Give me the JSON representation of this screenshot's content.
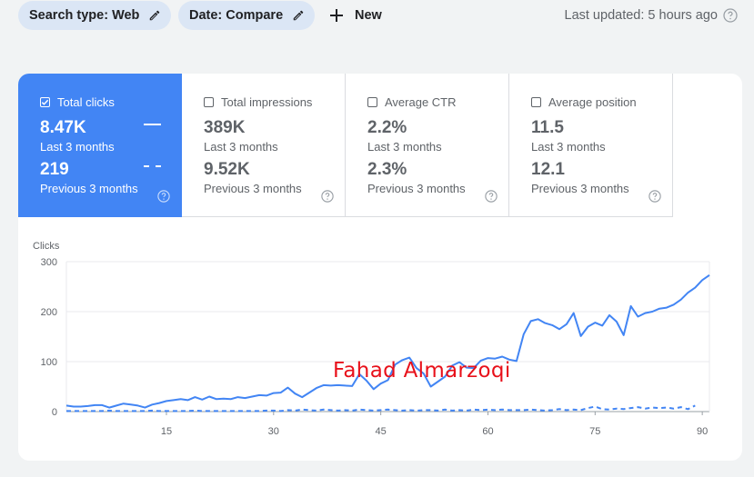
{
  "filters": {
    "search_type_label": "Search type: Web",
    "date_label": "Date: Compare"
  },
  "new_button": {
    "label": "New"
  },
  "last_updated": "Last updated: 5 hours ago",
  "metrics": [
    {
      "name": "Total clicks",
      "checked": true,
      "current_value": "8.47K",
      "current_period": "Last 3 months",
      "previous_value": "219",
      "previous_period": "Previous 3 months",
      "color": "#4285f4"
    },
    {
      "name": "Total impressions",
      "checked": false,
      "current_value": "389K",
      "current_period": "Last 3 months",
      "previous_value": "9.52K",
      "previous_period": "Previous 3 months"
    },
    {
      "name": "Average CTR",
      "checked": false,
      "current_value": "2.2%",
      "current_period": "Last 3 months",
      "previous_value": "2.3%",
      "previous_period": "Previous 3 months"
    },
    {
      "name": "Average position",
      "checked": false,
      "current_value": "11.5",
      "current_period": "Last 3 months",
      "previous_value": "12.1",
      "previous_period": "Previous 3 months"
    }
  ],
  "watermark": "Fahad Almarzoqi",
  "chart_data": {
    "type": "line",
    "ylabel": "Clicks",
    "xlabel": "",
    "ylim": [
      0,
      300
    ],
    "yticks": [
      0,
      100,
      200,
      300
    ],
    "xlim": [
      1,
      91
    ],
    "xticks": [
      15,
      30,
      45,
      60,
      75,
      90
    ],
    "grid": true,
    "colors": {
      "line": "#4285f4",
      "grid": "#e8eaed"
    },
    "series": [
      {
        "style": "solid",
        "x": [
          1,
          2,
          3,
          4,
          5,
          6,
          7,
          8,
          9,
          10,
          11,
          12,
          13,
          14,
          15,
          16,
          17,
          18,
          19,
          20,
          21,
          22,
          23,
          24,
          25,
          26,
          27,
          28,
          29,
          30,
          31,
          32,
          33,
          34,
          35,
          36,
          37,
          38,
          39,
          40,
          41,
          42,
          43,
          44,
          45,
          46,
          47,
          48,
          49,
          50,
          51,
          52,
          53,
          54,
          55,
          56,
          57,
          58,
          59,
          60,
          61,
          62,
          63,
          64,
          65,
          66,
          67,
          68,
          69,
          70,
          71,
          72,
          73,
          74,
          75,
          76,
          77,
          78,
          79,
          80,
          81,
          82,
          83,
          84,
          85,
          86,
          87,
          88,
          89,
          90,
          91
        ],
        "values": [
          12,
          10,
          10,
          11,
          13,
          13,
          8,
          12,
          16,
          14,
          12,
          8,
          14,
          17,
          21,
          23,
          25,
          23,
          29,
          24,
          30,
          25,
          26,
          25,
          29,
          27,
          30,
          33,
          32,
          37,
          38,
          48,
          36,
          29,
          38,
          47,
          53,
          52,
          53,
          52,
          51,
          75,
          62,
          45,
          56,
          63,
          94,
          103,
          108,
          87,
          76,
          50,
          60,
          70,
          92,
          99,
          88,
          87,
          102,
          107,
          106,
          110,
          104,
          101,
          155,
          181,
          185,
          177,
          173,
          165,
          175,
          197,
          151,
          170,
          178,
          172,
          193,
          180,
          153,
          211,
          190,
          197,
          200,
          206,
          208,
          214,
          224,
          238,
          248,
          263,
          273
        ]
      },
      {
        "style": "dashed",
        "x": [
          1,
          2,
          3,
          4,
          5,
          6,
          7,
          8,
          9,
          10,
          11,
          12,
          13,
          14,
          15,
          16,
          17,
          18,
          19,
          20,
          21,
          22,
          23,
          24,
          25,
          26,
          27,
          28,
          29,
          30,
          31,
          32,
          33,
          34,
          35,
          36,
          37,
          38,
          39,
          40,
          41,
          42,
          43,
          44,
          45,
          46,
          47,
          48,
          49,
          50,
          51,
          52,
          53,
          54,
          55,
          56,
          57,
          58,
          59,
          60,
          61,
          62,
          63,
          64,
          65,
          66,
          67,
          68,
          69,
          70,
          71,
          72,
          73,
          74,
          75,
          76,
          77,
          78,
          79,
          80,
          81,
          82,
          83,
          84,
          85,
          86,
          87,
          88,
          89
        ],
        "values": [
          1,
          1,
          1,
          1,
          1,
          1,
          2,
          1,
          1,
          1,
          1,
          1,
          2,
          1,
          1,
          1,
          1,
          1,
          2,
          1,
          1,
          1,
          1,
          1,
          1,
          1,
          1,
          1,
          2,
          2,
          1,
          3,
          2,
          4,
          3,
          2,
          4,
          3,
          2,
          3,
          2,
          4,
          3,
          2,
          3,
          4,
          3,
          2,
          3,
          2,
          3,
          3,
          2,
          4,
          2,
          3,
          2,
          4,
          3,
          4,
          3,
          4,
          3,
          3,
          3,
          4,
          3,
          2,
          3,
          5,
          3,
          4,
          3,
          7,
          10,
          5,
          4,
          6,
          5,
          7,
          9,
          6,
          8,
          7,
          8,
          6,
          9,
          5,
          12
        ]
      }
    ]
  }
}
